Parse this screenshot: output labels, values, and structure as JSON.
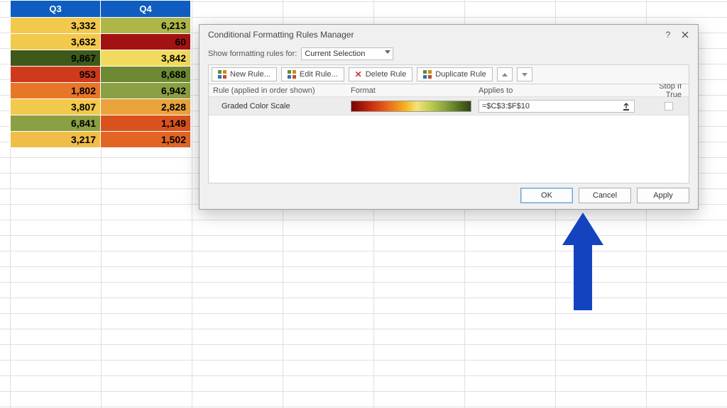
{
  "sheet": {
    "headers": [
      "Q3",
      "Q4"
    ],
    "rows": [
      {
        "q3": "3,332",
        "q4": "6,213",
        "q3_bg": "#f2c94c",
        "q4_bg": "#aeb64a"
      },
      {
        "q3": "3,632",
        "q4": "60",
        "q3_bg": "#f2c94c",
        "q4_bg": "#a31212"
      },
      {
        "q3": "9,867",
        "q4": "3,842",
        "q3_bg": "#3d5a1a",
        "q4_bg": "#f2da5e"
      },
      {
        "q3": "953",
        "q4": "8,688",
        "q3_bg": "#cf3a1c",
        "q4_bg": "#6d8a33"
      },
      {
        "q3": "1,802",
        "q4": "6,942",
        "q3_bg": "#e77629",
        "q4_bg": "#8ba042"
      },
      {
        "q3": "3,807",
        "q4": "2,828",
        "q3_bg": "#f2c94c",
        "q4_bg": "#eba33c"
      },
      {
        "q3": "6,841",
        "q4": "1,149",
        "q3_bg": "#8ba042",
        "q4_bg": "#d9521e"
      },
      {
        "q3": "3,217",
        "q4": "1,502",
        "q3_bg": "#f0be48",
        "q4_bg": "#e26524"
      }
    ]
  },
  "dialog": {
    "title": "Conditional Formatting Rules Manager",
    "scope_label": "Show formatting rules for:",
    "scope_value": "Current Selection",
    "toolbar": {
      "new": "New Rule...",
      "edit": "Edit Rule...",
      "delete": "Delete Rule",
      "duplicate": "Duplicate Rule"
    },
    "columns": {
      "rule": "Rule (applied in order shown)",
      "format": "Format",
      "applies": "Applies to",
      "stop": "Stop If True"
    },
    "rules": [
      {
        "name": "Graded Color Scale",
        "applies_to": "=$C$3:$F$10"
      }
    ],
    "footer": {
      "ok": "OK",
      "cancel": "Cancel",
      "apply": "Apply"
    }
  }
}
